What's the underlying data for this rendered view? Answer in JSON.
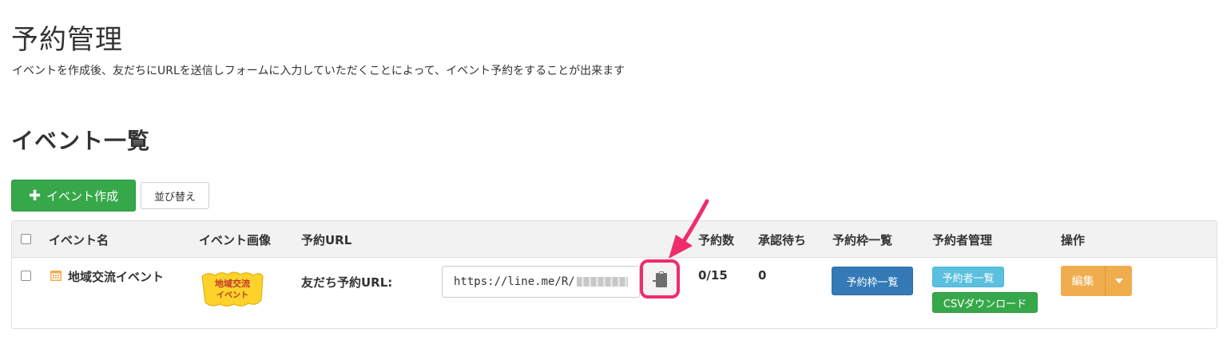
{
  "page": {
    "title": "予約管理",
    "description": "イベントを作成後、友だちにURLを送信しフォームに入力していただくことによって、イベント予約をすることが出来ます"
  },
  "section": {
    "title": "イベント一覧"
  },
  "toolbar": {
    "create_label": "イベント作成",
    "create_icon": "plus-icon",
    "sort_label": "並び替え"
  },
  "table": {
    "headers": {
      "event_name": "イベント名",
      "event_image": "イベント画像",
      "reserve_url": "予約URL",
      "reserve_count": "予約数",
      "pending": "承認待ち",
      "slots": "予約枠一覧",
      "reservers": "予約者管理",
      "actions": "操作"
    },
    "rows": [
      {
        "event_name": "地域交流イベント",
        "event_icon": "calendar-icon",
        "image_text_line1": "地域交流",
        "image_text_line2": "イベント",
        "url_label": "友だち予約URL:",
        "url_value": "https://line.me/R/",
        "copy_icon": "clipboard-copy-icon",
        "reserve_count": "0/15",
        "pending": "0",
        "slots_button": "予約枠一覧",
        "reservers_button": "予約者一覧",
        "csv_button": "CSVダウンロード",
        "edit_button": "編集"
      }
    ]
  },
  "colors": {
    "create": "#37a84a",
    "slots": "#337ab7",
    "reservers": "#5bc0de",
    "csv": "#37a84a",
    "edit": "#f0ad4e",
    "highlight": "#ef2d6b",
    "calendar": "#f0ad4e"
  }
}
